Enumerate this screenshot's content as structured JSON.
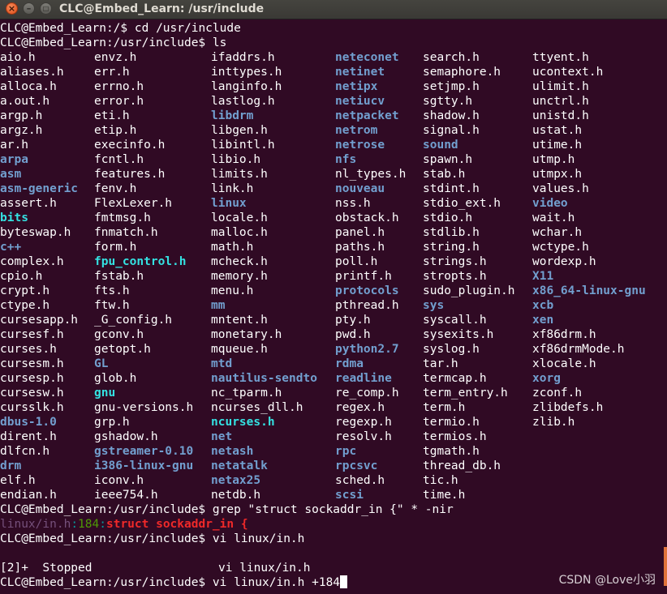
{
  "window": {
    "title": "CLC@Embed_Learn: /usr/include"
  },
  "terminal": {
    "prompt_home": "CLC@Embed_Learn:/$ ",
    "cmd_cd": "cd /usr/include",
    "prompt_inc": "CLC@Embed_Learn:/usr/include$ ",
    "cmd_ls": "ls",
    "cmd_grep": "grep \"struct sockaddr_in {\" * -nir",
    "grep_file": "linux/in.h",
    "grep_sep1": ":",
    "grep_line": "184",
    "grep_sep2": ":",
    "grep_match": "struct sockaddr_in {",
    "cmd_vi1": "vi linux/in.h",
    "job_status": "[2]+  Stopped",
    "job_cmd": "vi linux/in.h",
    "cmd_vi2": "vi linux/in.h +184"
  },
  "colors": {
    "background": "#300a24",
    "directory": "#729fcf",
    "executable": "#34e2e2",
    "text": "#ffffff"
  },
  "ls_columns": [
    [
      [
        "aio.h",
        "f"
      ],
      [
        "aliases.h",
        "f"
      ],
      [
        "alloca.h",
        "f"
      ],
      [
        "a.out.h",
        "f"
      ],
      [
        "argp.h",
        "f"
      ],
      [
        "argz.h",
        "f"
      ],
      [
        "ar.h",
        "f"
      ],
      [
        "arpa",
        "d"
      ],
      [
        "asm",
        "d"
      ],
      [
        "asm-generic",
        "d"
      ],
      [
        "assert.h",
        "f"
      ],
      [
        "bits",
        "x"
      ],
      [
        "byteswap.h",
        "f"
      ],
      [
        "c++",
        "d"
      ],
      [
        "complex.h",
        "f"
      ],
      [
        "cpio.h",
        "f"
      ],
      [
        "crypt.h",
        "f"
      ],
      [
        "ctype.h",
        "f"
      ],
      [
        "cursesapp.h",
        "f"
      ],
      [
        "cursesf.h",
        "f"
      ],
      [
        "curses.h",
        "f"
      ],
      [
        "cursesm.h",
        "f"
      ],
      [
        "cursesp.h",
        "f"
      ],
      [
        "cursesw.h",
        "f"
      ],
      [
        "cursslk.h",
        "f"
      ],
      [
        "dbus-1.0",
        "d"
      ],
      [
        "dirent.h",
        "f"
      ],
      [
        "dlfcn.h",
        "f"
      ],
      [
        "drm",
        "d"
      ],
      [
        "elf.h",
        "f"
      ],
      [
        "endian.h",
        "f"
      ]
    ],
    [
      [
        "envz.h",
        "f"
      ],
      [
        "err.h",
        "f"
      ],
      [
        "errno.h",
        "f"
      ],
      [
        "error.h",
        "f"
      ],
      [
        "eti.h",
        "f"
      ],
      [
        "etip.h",
        "f"
      ],
      [
        "execinfo.h",
        "f"
      ],
      [
        "fcntl.h",
        "f"
      ],
      [
        "features.h",
        "f"
      ],
      [
        "fenv.h",
        "f"
      ],
      [
        "FlexLexer.h",
        "f"
      ],
      [
        "fmtmsg.h",
        "f"
      ],
      [
        "fnmatch.h",
        "f"
      ],
      [
        "form.h",
        "f"
      ],
      [
        "fpu_control.h",
        "x"
      ],
      [
        "fstab.h",
        "f"
      ],
      [
        "fts.h",
        "f"
      ],
      [
        "ftw.h",
        "f"
      ],
      [
        "_G_config.h",
        "f"
      ],
      [
        "gconv.h",
        "f"
      ],
      [
        "getopt.h",
        "f"
      ],
      [
        "GL",
        "d"
      ],
      [
        "glob.h",
        "f"
      ],
      [
        "gnu",
        "x"
      ],
      [
        "gnu-versions.h",
        "f"
      ],
      [
        "grp.h",
        "f"
      ],
      [
        "gshadow.h",
        "f"
      ],
      [
        "gstreamer-0.10",
        "d"
      ],
      [
        "i386-linux-gnu",
        "d"
      ],
      [
        "iconv.h",
        "f"
      ],
      [
        "ieee754.h",
        "f"
      ]
    ],
    [
      [
        "ifaddrs.h",
        "f"
      ],
      [
        "inttypes.h",
        "f"
      ],
      [
        "langinfo.h",
        "f"
      ],
      [
        "lastlog.h",
        "f"
      ],
      [
        "libdrm",
        "d"
      ],
      [
        "libgen.h",
        "f"
      ],
      [
        "libintl.h",
        "f"
      ],
      [
        "libio.h",
        "f"
      ],
      [
        "limits.h",
        "f"
      ],
      [
        "link.h",
        "f"
      ],
      [
        "linux",
        "d"
      ],
      [
        "locale.h",
        "f"
      ],
      [
        "malloc.h",
        "f"
      ],
      [
        "math.h",
        "f"
      ],
      [
        "mcheck.h",
        "f"
      ],
      [
        "memory.h",
        "f"
      ],
      [
        "menu.h",
        "f"
      ],
      [
        "mm",
        "d"
      ],
      [
        "mntent.h",
        "f"
      ],
      [
        "monetary.h",
        "f"
      ],
      [
        "mqueue.h",
        "f"
      ],
      [
        "mtd",
        "d"
      ],
      [
        "nautilus-sendto",
        "d"
      ],
      [
        "nc_tparm.h",
        "f"
      ],
      [
        "ncurses_dll.h",
        "f"
      ],
      [
        "ncurses.h",
        "x"
      ],
      [
        "net",
        "d"
      ],
      [
        "netash",
        "d"
      ],
      [
        "netatalk",
        "d"
      ],
      [
        "netax25",
        "d"
      ],
      [
        "netdb.h",
        "f"
      ]
    ],
    [
      [
        "neteconet",
        "d"
      ],
      [
        "netinet",
        "d"
      ],
      [
        "netipx",
        "d"
      ],
      [
        "netiucv",
        "d"
      ],
      [
        "netpacket",
        "d"
      ],
      [
        "netrom",
        "d"
      ],
      [
        "netrose",
        "d"
      ],
      [
        "nfs",
        "d"
      ],
      [
        "nl_types.h",
        "f"
      ],
      [
        "nouveau",
        "d"
      ],
      [
        "nss.h",
        "f"
      ],
      [
        "obstack.h",
        "f"
      ],
      [
        "panel.h",
        "f"
      ],
      [
        "paths.h",
        "f"
      ],
      [
        "poll.h",
        "f"
      ],
      [
        "printf.h",
        "f"
      ],
      [
        "protocols",
        "d"
      ],
      [
        "pthread.h",
        "f"
      ],
      [
        "pty.h",
        "f"
      ],
      [
        "pwd.h",
        "f"
      ],
      [
        "python2.7",
        "d"
      ],
      [
        "rdma",
        "d"
      ],
      [
        "readline",
        "d"
      ],
      [
        "re_comp.h",
        "f"
      ],
      [
        "regex.h",
        "f"
      ],
      [
        "regexp.h",
        "f"
      ],
      [
        "resolv.h",
        "f"
      ],
      [
        "rpc",
        "d"
      ],
      [
        "rpcsvc",
        "d"
      ],
      [
        "sched.h",
        "f"
      ],
      [
        "scsi",
        "d"
      ]
    ],
    [
      [
        "search.h",
        "f"
      ],
      [
        "semaphore.h",
        "f"
      ],
      [
        "setjmp.h",
        "f"
      ],
      [
        "sgtty.h",
        "f"
      ],
      [
        "shadow.h",
        "f"
      ],
      [
        "signal.h",
        "f"
      ],
      [
        "sound",
        "d"
      ],
      [
        "spawn.h",
        "f"
      ],
      [
        "stab.h",
        "f"
      ],
      [
        "stdint.h",
        "f"
      ],
      [
        "stdio_ext.h",
        "f"
      ],
      [
        "stdio.h",
        "f"
      ],
      [
        "stdlib.h",
        "f"
      ],
      [
        "string.h",
        "f"
      ],
      [
        "strings.h",
        "f"
      ],
      [
        "stropts.h",
        "f"
      ],
      [
        "sudo_plugin.h",
        "f"
      ],
      [
        "sys",
        "d"
      ],
      [
        "syscall.h",
        "f"
      ],
      [
        "sysexits.h",
        "f"
      ],
      [
        "syslog.h",
        "f"
      ],
      [
        "tar.h",
        "f"
      ],
      [
        "termcap.h",
        "f"
      ],
      [
        "term_entry.h",
        "f"
      ],
      [
        "term.h",
        "f"
      ],
      [
        "termio.h",
        "f"
      ],
      [
        "termios.h",
        "f"
      ],
      [
        "tgmath.h",
        "f"
      ],
      [
        "thread_db.h",
        "f"
      ],
      [
        "tic.h",
        "f"
      ],
      [
        "time.h",
        "f"
      ]
    ],
    [
      [
        "ttyent.h",
        "f"
      ],
      [
        "ucontext.h",
        "f"
      ],
      [
        "ulimit.h",
        "f"
      ],
      [
        "unctrl.h",
        "f"
      ],
      [
        "unistd.h",
        "f"
      ],
      [
        "ustat.h",
        "f"
      ],
      [
        "utime.h",
        "f"
      ],
      [
        "utmp.h",
        "f"
      ],
      [
        "utmpx.h",
        "f"
      ],
      [
        "values.h",
        "f"
      ],
      [
        "video",
        "d"
      ],
      [
        "wait.h",
        "f"
      ],
      [
        "wchar.h",
        "f"
      ],
      [
        "wctype.h",
        "f"
      ],
      [
        "wordexp.h",
        "f"
      ],
      [
        "X11",
        "d"
      ],
      [
        "x86_64-linux-gnu",
        "d"
      ],
      [
        "xcb",
        "d"
      ],
      [
        "xen",
        "d"
      ],
      [
        "xf86drm.h",
        "f"
      ],
      [
        "xf86drmMode.h",
        "f"
      ],
      [
        "xlocale.h",
        "f"
      ],
      [
        "xorg",
        "d"
      ],
      [
        "zconf.h",
        "f"
      ],
      [
        "zlibdefs.h",
        "f"
      ],
      [
        "zlib.h",
        "f"
      ]
    ]
  ],
  "watermark": "CSDN @Love小羽"
}
